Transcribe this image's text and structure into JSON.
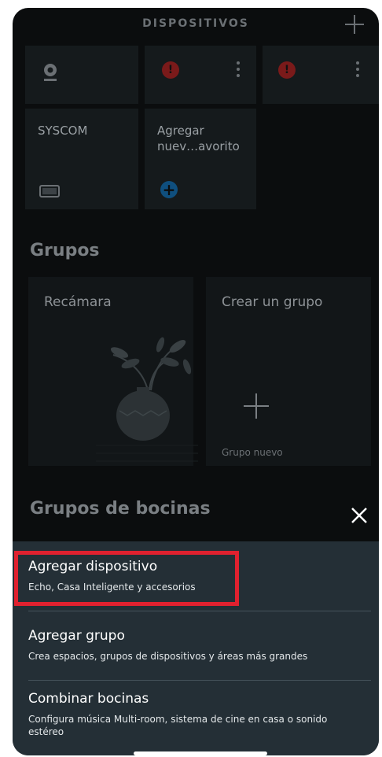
{
  "header": {
    "title": "DISPOSITIVOS",
    "add_icon": "plus-icon"
  },
  "devices": {
    "row1": [
      {
        "icon": "camera-icon",
        "menu": false
      },
      {
        "icon": "alert-icon",
        "alert_text": "!",
        "menu": true
      },
      {
        "icon": "alert-icon",
        "alert_text": "!",
        "menu": true
      }
    ],
    "row2": [
      {
        "label": "SYSCOM",
        "icon": "monitor-icon"
      },
      {
        "label_line1": "Agregar",
        "label_line2": "nuev…avorito",
        "icon": "add-circle-icon"
      }
    ]
  },
  "groups": {
    "title": "Grupos",
    "cards": [
      {
        "label": "Recámara",
        "illustration": "plant-vase-icon"
      },
      {
        "label": "Crear un grupo",
        "sublabel": "Grupo nuevo",
        "icon": "plus-icon"
      }
    ]
  },
  "speaker_groups": {
    "title": "Grupos de bocinas"
  },
  "overlay": {
    "close_icon": "close-icon"
  },
  "sheet": {
    "items": [
      {
        "title": "Agregar dispositivo",
        "subtitle": "Echo, Casa Inteligente y accesorios"
      },
      {
        "title": "Agregar grupo",
        "subtitle": "Crea espacios, grupos de dispositivos y áreas más grandes"
      },
      {
        "title": "Combinar bocinas",
        "subtitle": "Configura música Multi-room, sistema de cine en casa o sonido estéreo"
      }
    ]
  },
  "colors": {
    "highlight": "#e0212f",
    "sheet_bg": "#242f36",
    "alert": "#7a1a1a",
    "accent": "#0f4f7e"
  }
}
